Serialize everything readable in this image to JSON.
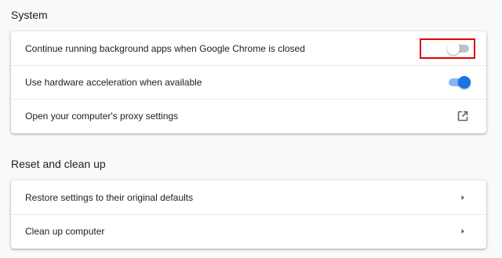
{
  "system": {
    "title": "System",
    "rows": [
      {
        "label": "Continue running background apps when Google Chrome is closed",
        "control": "toggle",
        "state": "off"
      },
      {
        "label": "Use hardware acceleration when available",
        "control": "toggle",
        "state": "on"
      },
      {
        "label": "Open your computer's proxy settings",
        "control": "open-in-new-icon"
      }
    ]
  },
  "reset": {
    "title": "Reset and clean up",
    "rows": [
      {
        "label": "Restore settings to their original defaults",
        "control": "arrow-right-icon"
      },
      {
        "label": "Clean up computer",
        "control": "arrow-right-icon"
      }
    ]
  },
  "colors": {
    "accent": "#1a73e8",
    "highlight": "#e00000"
  }
}
